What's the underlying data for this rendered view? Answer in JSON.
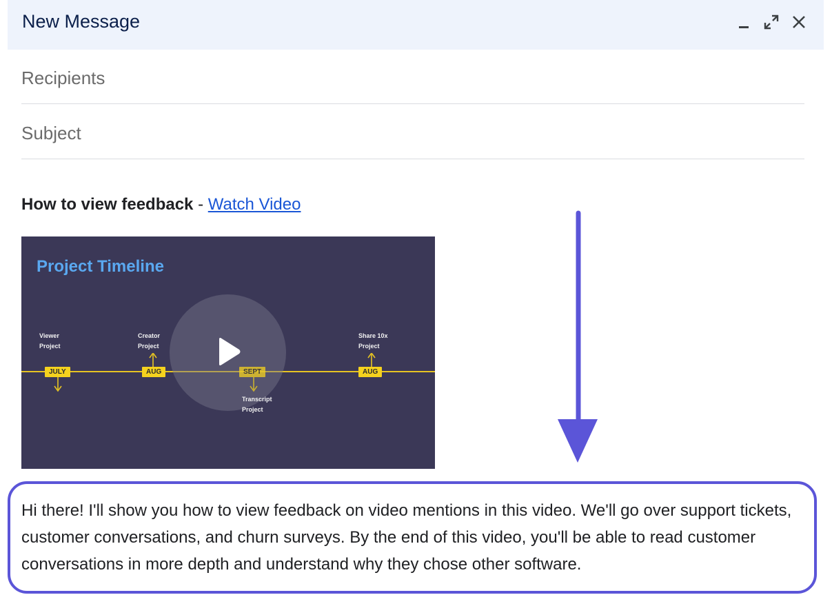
{
  "window": {
    "title": "New Message"
  },
  "header_icons": {
    "minimize": "minimize-icon",
    "expand": "expand-icon",
    "close": "close-icon"
  },
  "recipients": {
    "placeholder": "Recipients",
    "value": ""
  },
  "subject": {
    "placeholder": "Subject",
    "value": ""
  },
  "message": {
    "heading_bold": "How to view feedback",
    "heading_separator": " - ",
    "link_text": "Watch Video",
    "body": "Hi there! I'll show you how to view feedback on video mentions in this video. We'll go over support tickets, customer conversations, and churn surveys. By the end of this video, you'll be able to read customer conversations in more depth and understand why they chose other software."
  },
  "video_thumbnail": {
    "title": "Project Timeline",
    "milestones": [
      {
        "badge": "JULY",
        "label_1": "Viewer",
        "label_2": "Project"
      },
      {
        "badge": "AUG",
        "label_1": "Creator",
        "label_2": "Project"
      },
      {
        "badge": "SEPT",
        "label_1": "Transcript",
        "label_2": "Project"
      },
      {
        "badge": "AUG",
        "label_1": "Share 10x",
        "label_2": "Project"
      }
    ],
    "play_icon": "play-icon"
  },
  "colors": {
    "header_bg": "#eef3fc",
    "link": "#1a56d6",
    "highlight_border": "#5b55d8",
    "arrow": "#5b55d8",
    "video_bg": "#3b3857",
    "timeline": "#f5d21e"
  }
}
